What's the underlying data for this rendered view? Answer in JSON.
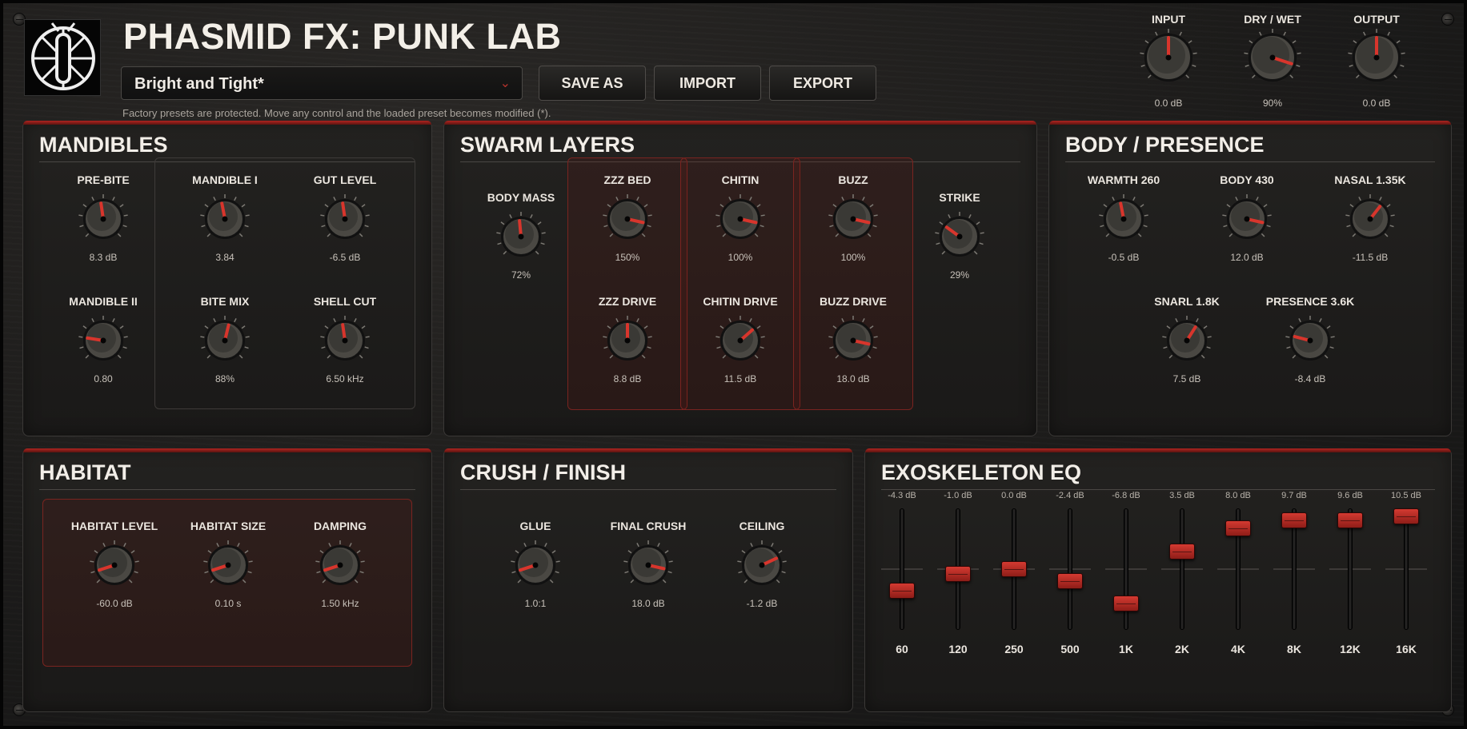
{
  "header": {
    "title": "PHASMID FX: PUNK LAB",
    "preset": "Bright and Tight*",
    "hint": "Factory presets are protected. Move any control and the loaded preset becomes modified (*).",
    "buttons": {
      "save_as": "SAVE AS",
      "import": "IMPORT",
      "export": "EXPORT"
    }
  },
  "master": [
    {
      "label": "INPUT",
      "value": "0.0 dB",
      "level": 0.5
    },
    {
      "label": "DRY / WET",
      "value": "90%",
      "level": 0.9
    },
    {
      "label": "OUTPUT",
      "value": "0.0 dB",
      "level": 0.5
    }
  ],
  "mandibles": {
    "title": "MANDIBLES",
    "knobs": [
      {
        "label": "PRE-BITE",
        "value": "8.3 dB",
        "level": 0.47
      },
      {
        "label": "MANDIBLE I",
        "value": "3.84",
        "level": 0.46
      },
      {
        "label": "GUT LEVEL",
        "value": "-6.5 dB",
        "level": 0.47
      },
      {
        "label": "MANDIBLE II",
        "value": "0.80",
        "level": 0.2
      },
      {
        "label": "BITE MIX",
        "value": "88%",
        "level": 0.55
      },
      {
        "label": "SHELL CUT",
        "value": "6.50 kHz",
        "level": 0.47
      }
    ]
  },
  "swarm": {
    "title": "SWARM LAYERS",
    "knobs": [
      {
        "label": "BODY MASS",
        "value": "72%",
        "level": 0.48
      },
      {
        "label": "ZZZ BED",
        "value": "150%",
        "level": 0.88
      },
      {
        "label": "CHITIN",
        "value": "100%",
        "level": 0.88
      },
      {
        "label": "BUZZ",
        "value": "100%",
        "level": 0.88
      },
      {
        "label": "STRIKE",
        "value": "29%",
        "level": 0.3
      },
      {
        "label": "ZZZ DRIVE",
        "value": "8.8 dB",
        "level": 0.5
      },
      {
        "label": "CHITIN DRIVE",
        "value": "11.5 dB",
        "level": 0.68
      },
      {
        "label": "BUZZ DRIVE",
        "value": "18.0 dB",
        "level": 0.88
      }
    ]
  },
  "body": {
    "title": "BODY / PRESENCE",
    "knobs": [
      {
        "label": "WARMTH 260",
        "value": "-0.5 dB",
        "level": 0.46
      },
      {
        "label": "BODY 430",
        "value": "12.0 dB",
        "level": 0.88
      },
      {
        "label": "NASAL 1.35K",
        "value": "-11.5 dB",
        "level": 0.64
      },
      {
        "label": "SNARL 1.8K",
        "value": "7.5 dB",
        "level": 0.62
      },
      {
        "label": "PRESENCE 3.6K",
        "value": "-8.4 dB",
        "level": 0.22
      }
    ]
  },
  "habitat": {
    "title": "HABITAT",
    "knobs": [
      {
        "label": "HABITAT LEVEL",
        "value": "-60.0 dB",
        "level": 0.1
      },
      {
        "label": "HABITAT SIZE",
        "value": "0.10 s",
        "level": 0.1
      },
      {
        "label": "DAMPING",
        "value": "1.50 kHz",
        "level": 0.1
      }
    ]
  },
  "crush": {
    "title": "CRUSH / FINISH",
    "knobs": [
      {
        "label": "GLUE",
        "value": "1.0:1",
        "level": 0.1
      },
      {
        "label": "FINAL CRUSH",
        "value": "18.0 dB",
        "level": 0.88
      },
      {
        "label": "CEILING",
        "value": "-1.2 dB",
        "level": 0.74
      }
    ]
  },
  "eq": {
    "title": "EXOSKELETON EQ",
    "bands": [
      {
        "freq": "60",
        "db": "-4.3 dB",
        "gain": -4.3
      },
      {
        "freq": "120",
        "db": "-1.0 dB",
        "gain": -1.0
      },
      {
        "freq": "250",
        "db": "0.0 dB",
        "gain": 0.0
      },
      {
        "freq": "500",
        "db": "-2.4 dB",
        "gain": -2.4
      },
      {
        "freq": "1K",
        "db": "-6.8 dB",
        "gain": -6.8
      },
      {
        "freq": "2K",
        "db": "3.5 dB",
        "gain": 3.5
      },
      {
        "freq": "4K",
        "db": "8.0 dB",
        "gain": 8.0
      },
      {
        "freq": "8K",
        "db": "9.7 dB",
        "gain": 9.7
      },
      {
        "freq": "12K",
        "db": "9.6 dB",
        "gain": 9.6
      },
      {
        "freq": "16K",
        "db": "10.5 dB",
        "gain": 10.5
      }
    ]
  },
  "colors": {
    "accent": "#b0241f",
    "pointer": "#d8352c",
    "knob_body": "#3a3935"
  }
}
